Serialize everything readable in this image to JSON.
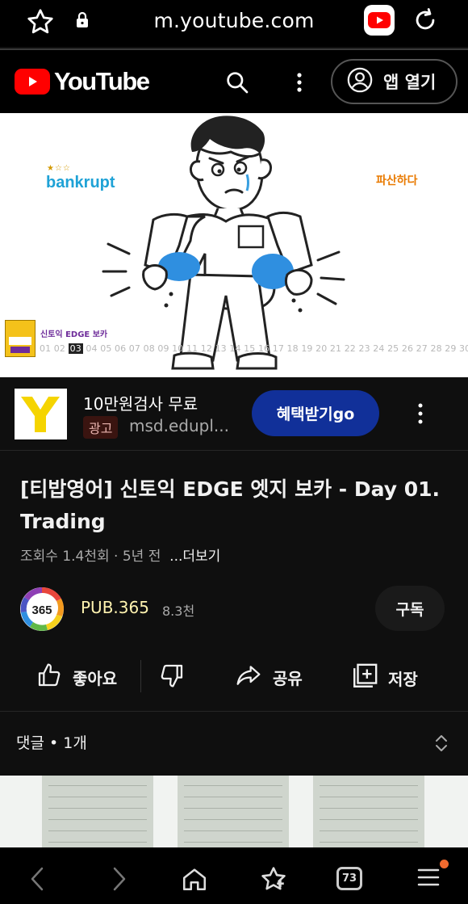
{
  "browser": {
    "url": "m.youtube.com",
    "tab_count": "73"
  },
  "header": {
    "logo_text": "YouTube",
    "open_app_label": "앱 열기"
  },
  "video_thumbnail": {
    "word_en": "bankrupt",
    "word_ko": "파산하다",
    "stars": "★☆☆",
    "book_label": "신토익 EDGE 보카",
    "book_cover_text": "신토익 EDGE 보카",
    "day_before": "01 02",
    "day_current": "03",
    "day_after": "04 05 06 07 08 09 10 11 12 13 14 15 16 17 18 19 20 21 22 23 24 25 26 27 28 29 30"
  },
  "ad": {
    "title": "10만원검사 무료",
    "badge": "광고",
    "site": "msd.edupl...",
    "cta_label": "혜택받기go"
  },
  "video": {
    "title": "[티밥영어] 신토익 EDGE 엣지 보카 - Day 01. Trading",
    "meta": "조회수 1.4천회 · 5년 전",
    "more_label": "...더보기"
  },
  "channel": {
    "name": "PUB.365",
    "subscribers": "8.3천",
    "avatar_text": "365",
    "subscribe_label": "구독"
  },
  "actions": {
    "like_label": "좋아요",
    "share_label": "공유",
    "save_label": "저장"
  },
  "comments": {
    "label": "댓글 • 1개"
  },
  "colors": {
    "youtube_red": "#ff0000",
    "cta_blue": "#113099",
    "background": "#0f0f0f",
    "notification_dot": "#f26a2e"
  }
}
